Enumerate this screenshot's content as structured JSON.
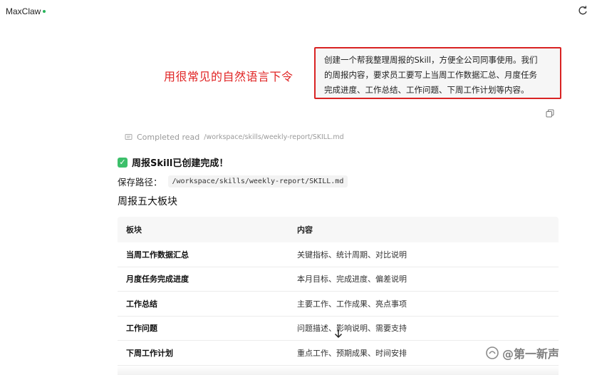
{
  "header": {
    "app_name": "MaxClaw",
    "status_color": "#27b35a"
  },
  "annotation": {
    "text": "用很常见的自然语言下令"
  },
  "user_message": {
    "lines": [
      "创建一个帮我整理周报的Skill，方便全公司同事使用。我们",
      "的周报内容，要求员工要写上当周工作数据汇总、月度任务",
      "完成进度、工作总结、工作问题、下周工作计划等内容。"
    ]
  },
  "completed_read": {
    "label": "Completed read",
    "path": "/workspace/skills/weekly-report/SKILL.md"
  },
  "result": {
    "success_text": "周报Skill已创建完成！",
    "save_label": "保存路径：",
    "save_path": "/workspace/skills/weekly-report/SKILL.md",
    "section_title": "周报五大板块"
  },
  "table": {
    "headers": [
      "板块",
      "内容"
    ],
    "rows": [
      [
        "当周工作数据汇总",
        "关键指标、统计周期、对比说明"
      ],
      [
        "月度任务完成进度",
        "本月目标、完成进度、偏差说明"
      ],
      [
        "工作总结",
        "主要工作、工作成果、亮点事项"
      ],
      [
        "工作问题",
        "问题描述、影响说明、需要支持"
      ],
      [
        "下周工作计划",
        "重点工作、预期成果、时间安排"
      ]
    ]
  },
  "watermark": {
    "text": "@第一新声"
  },
  "colors": {
    "accent_red": "#d92323",
    "success_green": "#3cbf6a"
  }
}
